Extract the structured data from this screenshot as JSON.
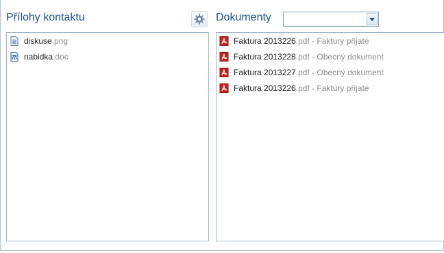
{
  "left_panel": {
    "title": "Přílohy kontaktu",
    "settings_icon": "gear-icon",
    "items": [
      {
        "name": "diskuse",
        "ext": ".png",
        "icon": "image-file-icon"
      },
      {
        "name": "nabidka",
        "ext": ".doc",
        "icon": "word-file-icon"
      }
    ]
  },
  "right_panel": {
    "title": "Dokumenty",
    "select": {
      "value": ""
    },
    "items": [
      {
        "name": "Faktura 2013226",
        "ext": ".pdf",
        "sep": " - ",
        "category": "Faktury přijaté",
        "icon": "pdf-file-icon"
      },
      {
        "name": "Faktura 2013228",
        "ext": ".pdf",
        "sep": " - ",
        "category": "Obecný dokument",
        "icon": "pdf-file-icon"
      },
      {
        "name": "Faktura 2013227",
        "ext": ".pdf",
        "sep": " - ",
        "category": "Obecný dokument",
        "icon": "pdf-file-icon"
      },
      {
        "name": "Faktura 2013226",
        "ext": ".pdf",
        "sep": " - ",
        "category": "Faktury přijaté",
        "icon": "pdf-file-icon"
      }
    ]
  },
  "colors": {
    "title": "#1d4f91",
    "border": "#9fb4d2",
    "pdf_red": "#c8211b"
  }
}
